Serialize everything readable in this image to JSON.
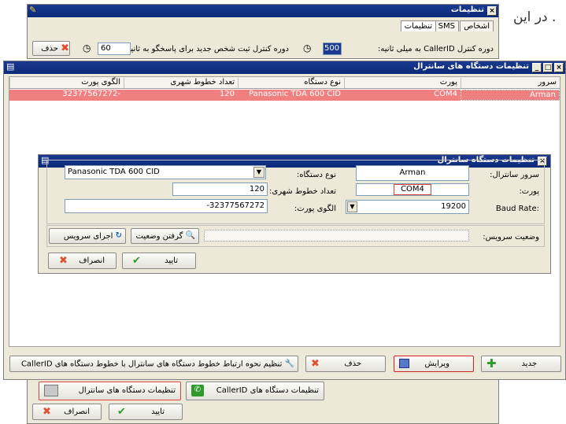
{
  "background_text": ". در این",
  "settings_window": {
    "title": "تنظیمات",
    "tabs": [
      "اشخاص",
      "SMS",
      "تنظیمات"
    ],
    "callerid_period_label": "دوره کنترل CallerID به میلی ثانیه:",
    "callerid_period_value": "500",
    "register_period_label": "دوره کنترل ثبت شخص جدید برای پاسخگو به ثانیه:",
    "register_period_value": "60",
    "delete_label": "حذف"
  },
  "central_list_window": {
    "title": "تنظیمات دستگاه های سانترال",
    "columns": [
      "سرور",
      "پورت",
      "نوع دستگاه",
      "تعداد خطوط شهری",
      "الگوی پورت"
    ],
    "rows": [
      {
        "server": "Arman",
        "port": "COM4",
        "device_type": "Panasonic TDA 600 CID",
        "lines": "120",
        "pattern": "32377567272-"
      }
    ],
    "new_label": "جدید",
    "edit_label": "ویرایش",
    "delete_label": "حذف",
    "link_label": "تنظیم نحوه ارتباط خطوط دستگاه های سانترال با خطوط دستگاه های CallerID"
  },
  "device_dialog": {
    "title": "تنظیمات دستگاه سانترال",
    "server_label": "سرور سانترال:",
    "server_value": "Arman",
    "port_label": "پورت:",
    "port_value": "COM4",
    "baud_label": ":Baud Rate",
    "baud_value": "19200",
    "device_type_label": "نوع دستگاه:",
    "device_type_value": "Panasonic TDA 600 CID",
    "lines_label": "تعداد خطوط شهری:",
    "lines_value": "120",
    "pattern_label": "الگوی پورت:",
    "pattern_value": "-32377567272",
    "service_status_label": "وضعیت سرویس:",
    "get_status_label": "گرفتن وضعیت",
    "run_service_label": "اجرای سرویس",
    "ok_label": "تایید",
    "cancel_label": "انصراف"
  },
  "bottom_panel": {
    "callerid_devices_label": "تنظیمات دستگاه های CallerID",
    "central_devices_label": "تنظیمات دستگاه های سانترال",
    "ok_label": "تایید",
    "cancel_label": "انصراف"
  }
}
